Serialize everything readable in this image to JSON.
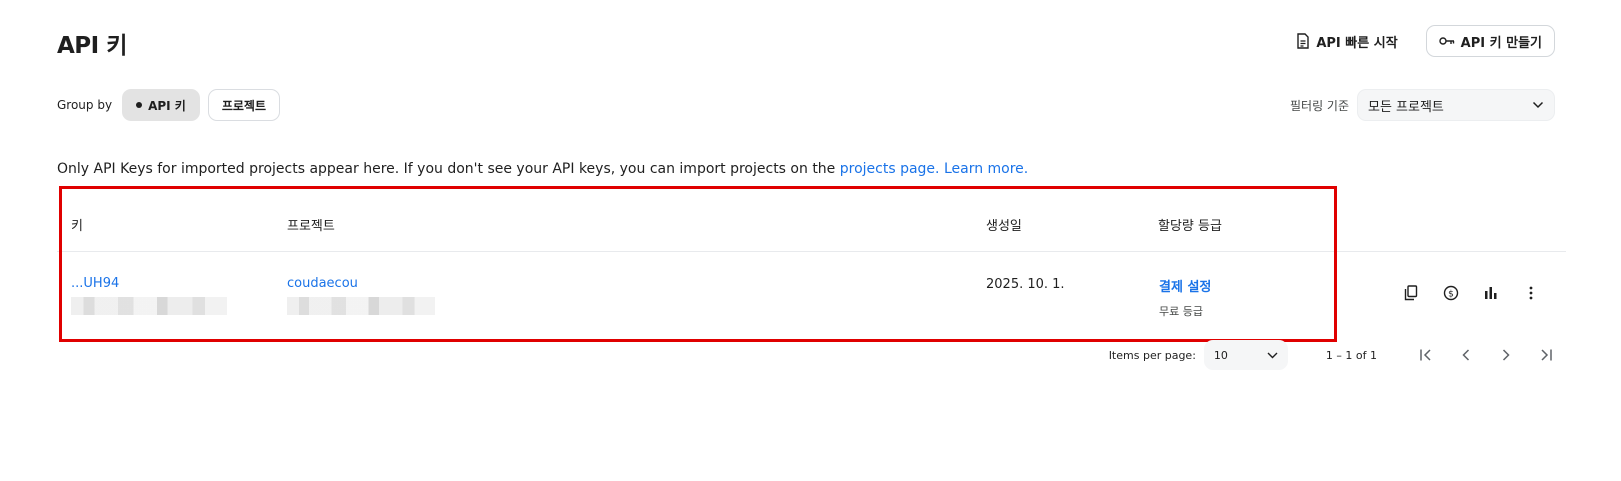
{
  "header": {
    "title": "API 키",
    "quickstart_label": "API 빠른 시작",
    "create_key_label": "API 키 만들기"
  },
  "group_by": {
    "label": "Group by",
    "options": [
      "API 키",
      "프로젝트"
    ],
    "selected": "API 키"
  },
  "filter": {
    "label": "필터링 기준",
    "value": "모든 프로젝트"
  },
  "info": {
    "text": "Only API Keys for imported projects appear here. If you don't see your API keys, you can import projects on the ",
    "link1": "projects page.",
    "link2": "Learn more."
  },
  "table": {
    "columns": [
      "키",
      "프로젝트",
      "생성일",
      "할당량 등급"
    ],
    "rows": [
      {
        "key": "...UH94",
        "project": "coudaecou",
        "created": "2025. 10. 1.",
        "tier_link": "결제 설정",
        "tier": "무료 등급"
      }
    ]
  },
  "pagination": {
    "items_per_page_label": "Items per page:",
    "items_per_page": "10",
    "range": "1 – 1 of 1"
  },
  "icons": {
    "row_actions": [
      "copy-icon",
      "dollar-icon",
      "bar-chart-icon",
      "more-vert-icon"
    ],
    "pager": [
      "first-page-icon",
      "prev-page-icon",
      "next-page-icon",
      "last-page-icon"
    ]
  },
  "colors": {
    "link": "#1a73e8",
    "highlight": "#e00000"
  }
}
